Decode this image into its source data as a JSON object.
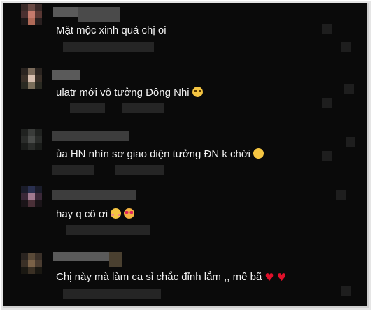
{
  "comments": [
    {
      "text": "Mặt mộc xinh quá chị oi",
      "emojis": []
    },
    {
      "text": "ulatr mới vô tưởng Đông Nhi",
      "emojis": [
        "grinning-sweat-emoji"
      ]
    },
    {
      "text": "ủa HN nhìn sơ giao diện tưởng ĐN k chời",
      "emojis": [
        "rolling-laughing-emoji"
      ]
    },
    {
      "text": "hay q cô ơi",
      "emojis": [
        "blush-emoji",
        "heart-eyes-emoji"
      ]
    },
    {
      "text": "Chị này mà làm ca sỉ chắc đỉnh lắm ,, mê bã",
      "emojis": [
        "red-heart",
        "red-heart"
      ]
    }
  ],
  "colors": {
    "background": "#0a0a0a",
    "text": "#f2f2f2",
    "heart": "#e0102a",
    "frame_border": "#e5e5e5"
  }
}
